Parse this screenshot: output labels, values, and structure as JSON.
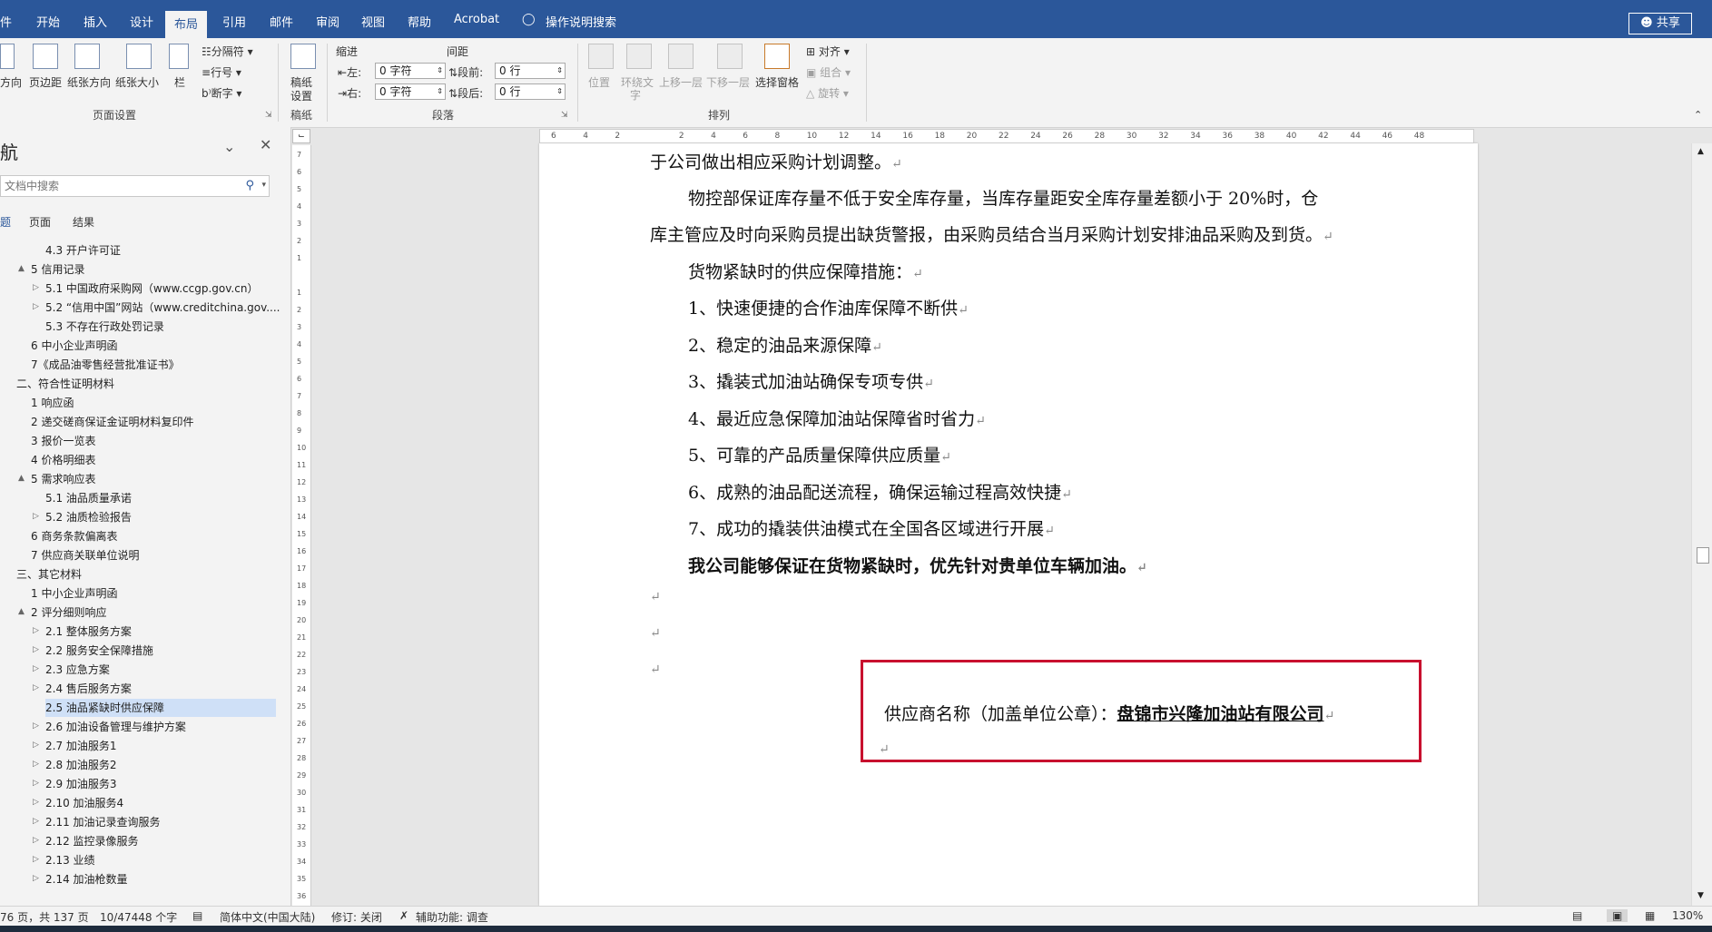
{
  "menu": {
    "tabs": [
      "件",
      "开始",
      "插入",
      "设计",
      "布局",
      "引用",
      "邮件",
      "审阅",
      "视图",
      "帮助",
      "Acrobat"
    ],
    "active_tab": "布局",
    "search_tip": "操作说明搜索",
    "share": "共享"
  },
  "ribbon": {
    "page_setup": {
      "buttons": [
        "方向",
        "页边距",
        "纸张方向",
        "纸张大小",
        "栏"
      ],
      "small": [
        "分隔符",
        "行号",
        "断字"
      ],
      "group": "页面设置"
    },
    "draft": {
      "button": "稿纸\n设置",
      "button_l1": "稿纸",
      "button_l2": "设置",
      "group": "稿纸"
    },
    "paragraph": {
      "indent_label": "缩进",
      "spacing_label": "间距",
      "left_label": "左:",
      "right_label": "右:",
      "left_value": "0 字符",
      "right_value": "0 字符",
      "before_label": "段前:",
      "after_label": "段后:",
      "before_value": "0 行",
      "after_value": "0 行",
      "group": "段落"
    },
    "arrange": {
      "position": "位置",
      "wrap_l1": "环绕文",
      "wrap_l2": "字",
      "forward": "上移一层",
      "backward": "下移一层",
      "selection_pane": "选择窗格",
      "align": "对齐",
      "group_btn": "组合",
      "rotate": "旋转",
      "group": "排列"
    }
  },
  "nav": {
    "title": "航",
    "search_placeholder": "文档中搜索",
    "tabs": [
      "题",
      "页面",
      "结果"
    ],
    "items": [
      {
        "text": "4.3 开户许可证",
        "indent": 2,
        "toggle": ""
      },
      {
        "text": "5 信用记录",
        "indent": 1,
        "toggle": "▲"
      },
      {
        "text": "5.1 中国政府采购网（www.ccgp.gov.cn）",
        "indent": 2,
        "toggle": "▷"
      },
      {
        "text": "5.2 “信用中国”网站（www.creditchina.gov....",
        "indent": 2,
        "toggle": "▷"
      },
      {
        "text": "5.3 不存在行政处罚记录",
        "indent": 2,
        "toggle": ""
      },
      {
        "text": "6 中小企业声明函",
        "indent": 1,
        "toggle": ""
      },
      {
        "text": "7《成品油零售经营批准证书》",
        "indent": 1,
        "toggle": ""
      },
      {
        "text": "二、符合性证明材料",
        "indent": 0,
        "toggle": ""
      },
      {
        "text": "1 响应函",
        "indent": 1,
        "toggle": ""
      },
      {
        "text": "2 递交磋商保证金证明材料复印件",
        "indent": 1,
        "toggle": ""
      },
      {
        "text": "3 报价一览表",
        "indent": 1,
        "toggle": ""
      },
      {
        "text": "4 价格明细表",
        "indent": 1,
        "toggle": ""
      },
      {
        "text": "5 需求响应表",
        "indent": 1,
        "toggle": "▲"
      },
      {
        "text": "5.1 油品质量承诺",
        "indent": 2,
        "toggle": ""
      },
      {
        "text": "5.2 油质检验报告",
        "indent": 2,
        "toggle": "▷"
      },
      {
        "text": "6 商务条款偏离表",
        "indent": 1,
        "toggle": ""
      },
      {
        "text": "7 供应商关联单位说明",
        "indent": 1,
        "toggle": ""
      },
      {
        "text": "三、其它材料",
        "indent": 0,
        "toggle": ""
      },
      {
        "text": "1 中小企业声明函",
        "indent": 1,
        "toggle": ""
      },
      {
        "text": "2 评分细则响应",
        "indent": 1,
        "toggle": "▲"
      },
      {
        "text": "2.1 整体服务方案",
        "indent": 2,
        "toggle": "▷"
      },
      {
        "text": "2.2 服务安全保障措施",
        "indent": 2,
        "toggle": "▷"
      },
      {
        "text": "2.3 应急方案",
        "indent": 2,
        "toggle": "▷"
      },
      {
        "text": "2.4 售后服务方案",
        "indent": 2,
        "toggle": "▷"
      },
      {
        "text": "2.5 油品紧缺时供应保障",
        "indent": 2,
        "toggle": "",
        "selected": true
      },
      {
        "text": "2.6 加油设备管理与维护方案",
        "indent": 2,
        "toggle": "▷"
      },
      {
        "text": "2.7 加油服务1",
        "indent": 2,
        "toggle": "▷"
      },
      {
        "text": "2.8 加油服务2",
        "indent": 2,
        "toggle": "▷"
      },
      {
        "text": "2.9 加油服务3",
        "indent": 2,
        "toggle": "▷"
      },
      {
        "text": "2.10 加油服务4",
        "indent": 2,
        "toggle": "▷"
      },
      {
        "text": "2.11 加油记录查询服务",
        "indent": 2,
        "toggle": "▷"
      },
      {
        "text": "2.12 监控录像服务",
        "indent": 2,
        "toggle": "▷"
      },
      {
        "text": "2.13 业绩",
        "indent": 2,
        "toggle": "▷"
      },
      {
        "text": "2.14 加油枪数量",
        "indent": 2,
        "toggle": "▷"
      }
    ]
  },
  "doc": {
    "lines": [
      "于公司做出相应采购计划调整。",
      "物控部保证库存量不低于安全库存量，当库存量距安全库存量差额小于 20%时，仓",
      "库主管应及时向采购员提出缺货警报，由采购员结合当月采购计划安排油品采购及到货。",
      "货物紧缺时的供应保障措施：",
      "1、快速便捷的合作油库保障不断供",
      "2、稳定的油品来源保障",
      "3、撬装式加油站确保专项专供",
      "4、最近应急保障加油站保障省时省力",
      "5、可靠的产品质量保障供应质量",
      "6、成熟的油品配送流程，确保运输过程高效快捷",
      "7、成功的撬装供油模式在全国各区域进行开展",
      "我公司能够保证在货物紧缺时，优先针对贵单位车辆加油。"
    ],
    "supplier_label": "供应商名称（加盖单位公章）：",
    "supplier_name": "盘锦市兴隆加油站有限公司",
    "para_mark": "↵"
  },
  "ruler": {
    "h": [
      "6",
      "4",
      "2",
      "",
      "2",
      "4",
      "6",
      "8",
      "10",
      "12",
      "14",
      "16",
      "18",
      "20",
      "22",
      "24",
      "26",
      "28",
      "30",
      "32",
      "34",
      "36",
      "38",
      "40",
      "42",
      "44",
      "46",
      "48"
    ],
    "v": [
      "7",
      "6",
      "5",
      "4",
      "3",
      "2",
      "1",
      "",
      "1",
      "2",
      "3",
      "4",
      "5",
      "6",
      "7",
      "8",
      "9",
      "10",
      "11",
      "12",
      "13",
      "14",
      "15",
      "16",
      "17",
      "18",
      "19",
      "20",
      "21",
      "22",
      "23",
      "24",
      "25",
      "26",
      "27",
      "28",
      "29",
      "30",
      "31",
      "32",
      "33",
      "34",
      "35",
      "36"
    ]
  },
  "status": {
    "page": "76 页，共 137 页",
    "words": "10/47448 个字",
    "lang": "简体中文(中国大陆)",
    "track": "修订: 关闭",
    "access": "辅助功能: 调查",
    "zoom": "130%"
  },
  "colors": {
    "brand": "#2b579a",
    "stamp_box": "#c8102e",
    "nav_selected": "#cfe0f7"
  }
}
